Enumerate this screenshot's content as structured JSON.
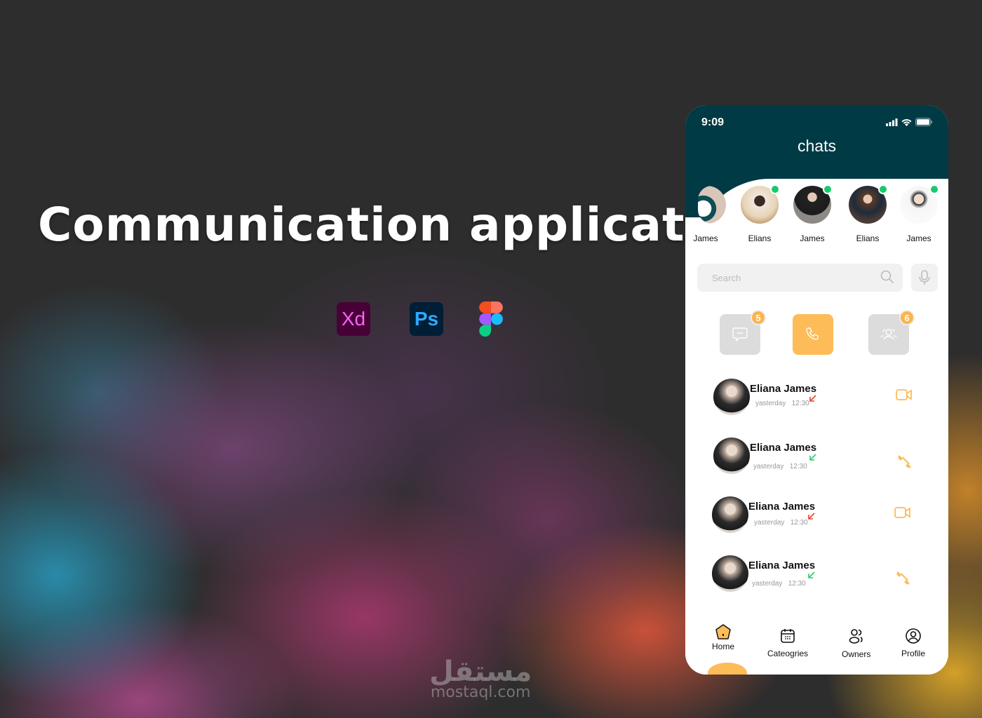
{
  "poster": {
    "title": "Communication application",
    "tools": [
      {
        "name": "xd",
        "label": "Xd",
        "bg": "#470137",
        "fg": "#ff61f6"
      },
      {
        "name": "ps",
        "label": "Ps",
        "bg": "#001e36",
        "fg": "#31a8ff"
      },
      {
        "name": "figma",
        "label": ""
      }
    ],
    "watermark_ar": "مستقل",
    "watermark_en": "mostaql.com"
  },
  "phone": {
    "status": {
      "time": "9:09"
    },
    "header": {
      "title": "chats",
      "bg": "#003a45"
    },
    "stories": [
      {
        "name": "James",
        "online": false
      },
      {
        "name": "Elians",
        "online": true
      },
      {
        "name": "James",
        "online": true
      },
      {
        "name": "Elians",
        "online": true
      },
      {
        "name": "James",
        "online": true
      }
    ],
    "search": {
      "placeholder": "Search"
    },
    "categories": [
      {
        "name": "messages",
        "icon": "chat-bubble-icon",
        "badge": "5",
        "active": false
      },
      {
        "name": "calls",
        "icon": "phone-icon",
        "badge": "",
        "active": true
      },
      {
        "name": "groups",
        "icon": "group-icon",
        "badge": "6",
        "active": false
      }
    ],
    "calls": [
      {
        "name": "Eliana James",
        "day": "yasterday",
        "time": "12:30",
        "direction": "missed",
        "type": "video"
      },
      {
        "name": "Eliana James",
        "day": "yasterday",
        "time": "12:30",
        "direction": "incoming",
        "type": "voice"
      },
      {
        "name": "Eliana James",
        "day": "yasterday",
        "time": "12:30",
        "direction": "missed",
        "type": "video"
      },
      {
        "name": "Eliana James",
        "day": "yasterday",
        "time": "12:30",
        "direction": "incoming",
        "type": "voice"
      }
    ],
    "nav": [
      {
        "label": "Home",
        "active": true
      },
      {
        "label": "Cateogries",
        "active": false
      },
      {
        "label": "Owners",
        "active": false
      },
      {
        "label": "Profile",
        "active": false
      }
    ],
    "colors": {
      "accent": "#fdbc58",
      "online": "#18c96c",
      "missed": "#e8452c",
      "incoming": "#2ecc71"
    }
  }
}
